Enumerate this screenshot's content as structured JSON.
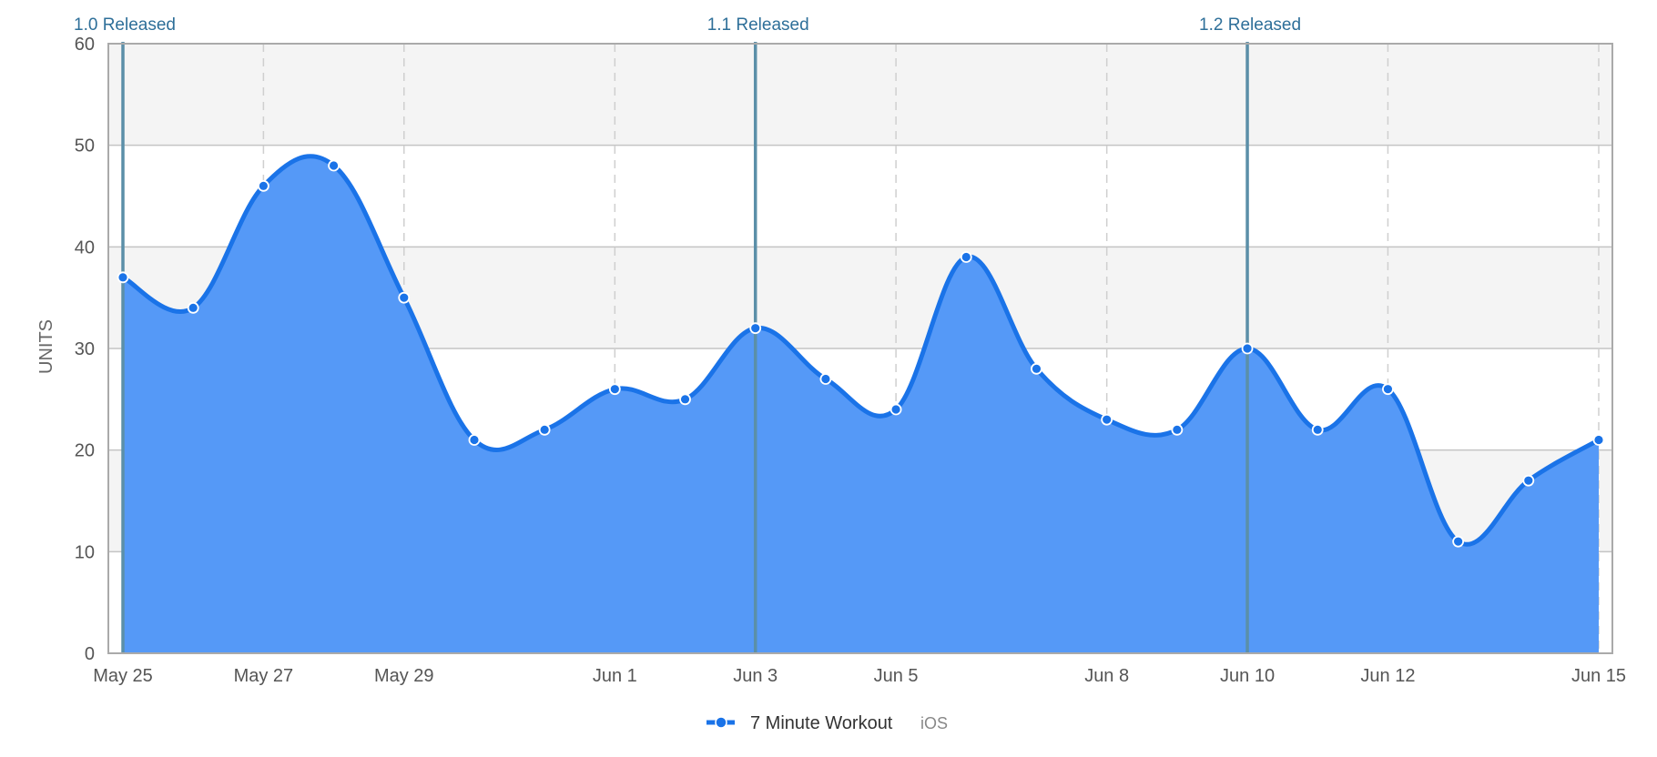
{
  "chart_data": {
    "type": "area",
    "title": "",
    "xlabel": "",
    "ylabel": "UNITS",
    "ylim": [
      0,
      60
    ],
    "yticks": [
      0,
      10,
      20,
      30,
      40,
      50,
      60
    ],
    "grid": "horizontal solid, alternating bands; vertical dashed at labeled dates",
    "dates": [
      "May 25",
      "May 26",
      "May 27",
      "May 28",
      "May 29",
      "May 30",
      "May 31",
      "Jun 1",
      "Jun 2",
      "Jun 3",
      "Jun 4",
      "Jun 5",
      "Jun 6",
      "Jun 7",
      "Jun 8",
      "Jun 9",
      "Jun 10",
      "Jun 11",
      "Jun 12",
      "Jun 13",
      "Jun 14",
      "Jun 15"
    ],
    "xtick_labels": [
      "May 25",
      "May 27",
      "May 29",
      "Jun 1",
      "Jun 3",
      "Jun 5",
      "Jun 8",
      "Jun 10",
      "Jun 12",
      "Jun 15"
    ],
    "series": [
      {
        "name": "7 Minute Workout",
        "platform": "iOS",
        "color": "#1a73e8",
        "fill": "#5599f7",
        "values": [
          37,
          34,
          46,
          48,
          35,
          21,
          22,
          26,
          25,
          32,
          27,
          24,
          39,
          28,
          23,
          22,
          30,
          22,
          26,
          11,
          17,
          21
        ]
      }
    ],
    "annotations": [
      {
        "date": "May 25",
        "label": "1.0 Released"
      },
      {
        "date": "Jun 3",
        "label": "1.1 Released"
      },
      {
        "date": "Jun 10",
        "label": "1.2 Released"
      }
    ],
    "legend_position": "bottom-center"
  },
  "colors": {
    "line": "#1a73e8",
    "area": "#5599f7",
    "release_line": "#5b8fa8",
    "release_text": "#2e6f99",
    "band": "#f4f4f4"
  }
}
